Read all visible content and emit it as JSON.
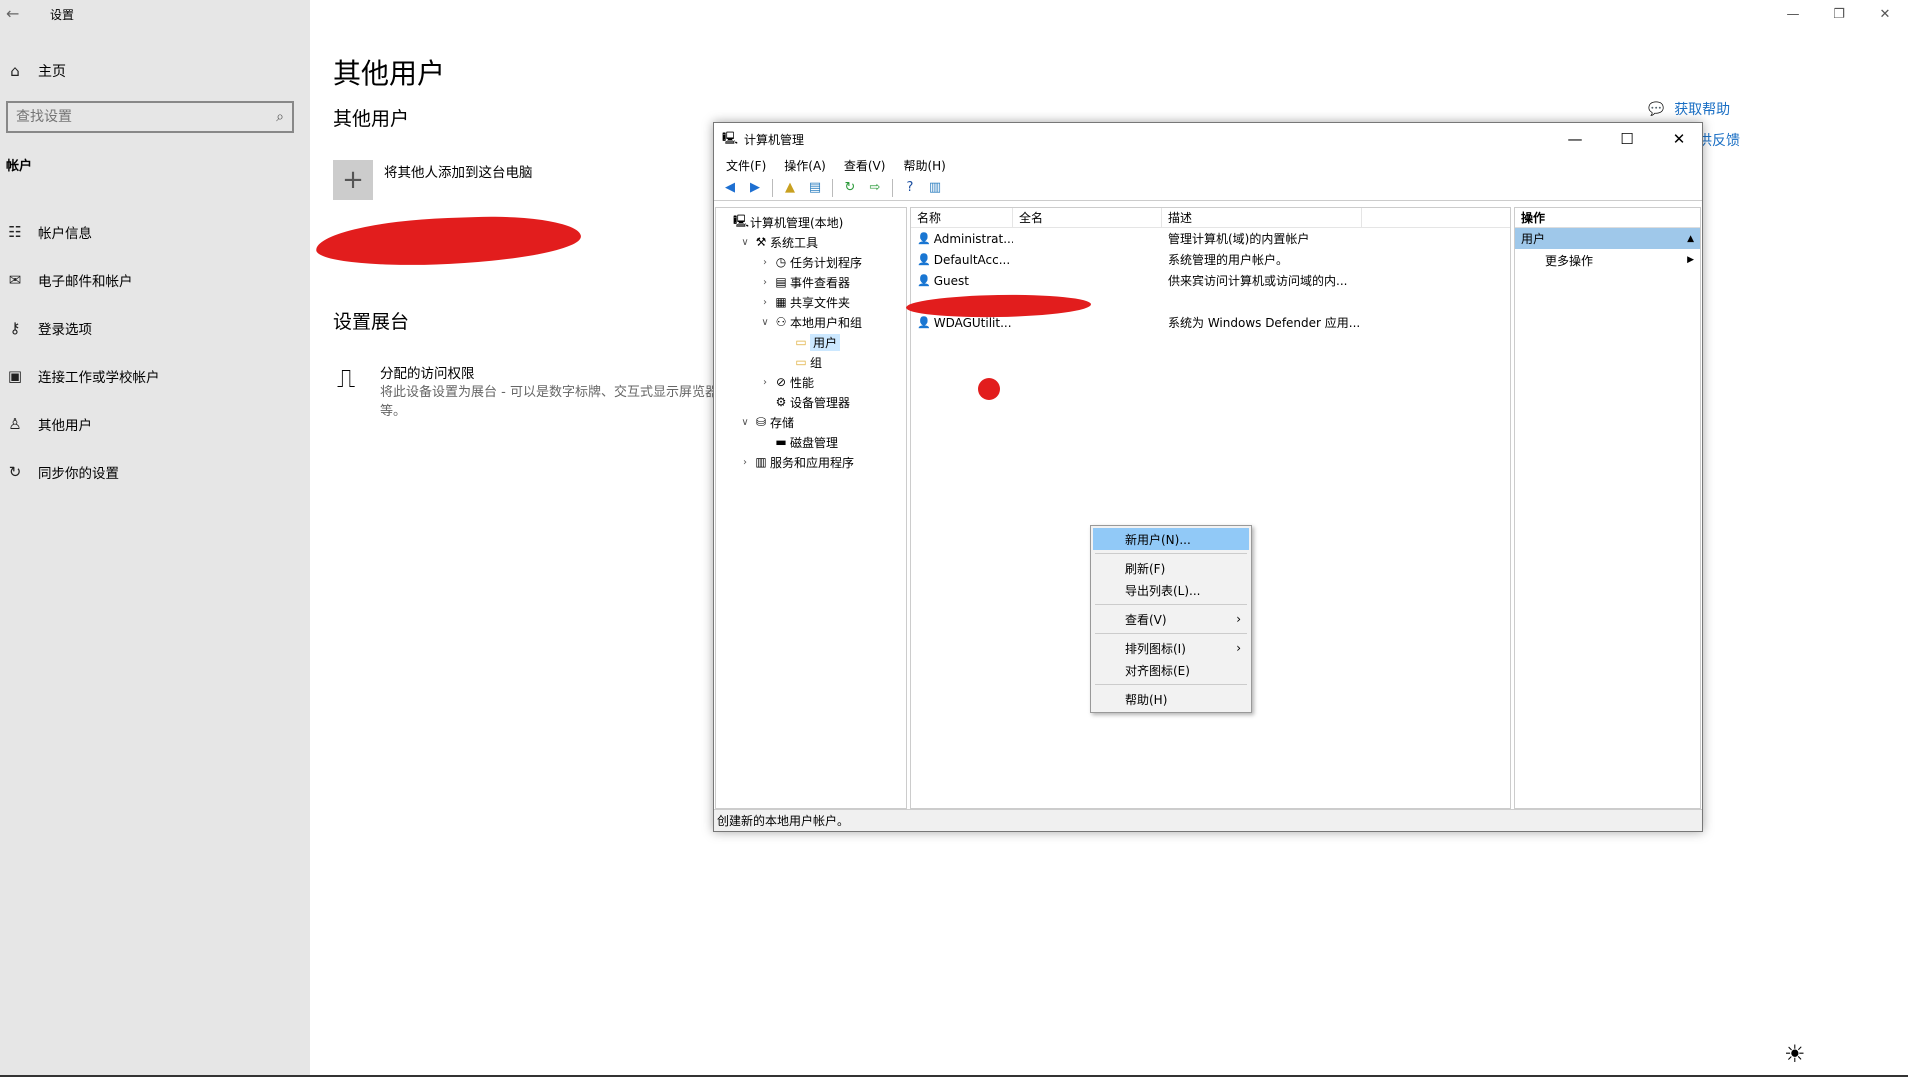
{
  "settings": {
    "title": "设置",
    "home": "主页",
    "search_placeholder": "查找设置",
    "section": "帐户",
    "nav": [
      {
        "label": "帐户信息",
        "icon": "person-card-icon",
        "glyph": "☷"
      },
      {
        "label": "电子邮件和帐户",
        "icon": "mail-icon",
        "glyph": "✉"
      },
      {
        "label": "登录选项",
        "icon": "key-icon",
        "glyph": "⚷"
      },
      {
        "label": "连接工作或学校帐户",
        "icon": "briefcase-icon",
        "glyph": "▣"
      },
      {
        "label": "其他用户",
        "icon": "person-add-icon",
        "glyph": "♙"
      },
      {
        "label": "同步你的设置",
        "icon": "sync-icon",
        "glyph": "↻"
      }
    ],
    "page_title": "其他用户",
    "other_users_heading": "其他用户",
    "add_user_label": "将其他人添加到这台电脑",
    "kiosk_heading": "设置展台",
    "kiosk_title": "分配的访问权限",
    "kiosk_desc": "将此设备设置为展台 - 可以是数字标牌、交互式显示屏览器等。",
    "help_link": "获取帮助",
    "feedback_link": "供反馈"
  },
  "cm": {
    "title": "计算机管理",
    "menu": [
      "文件(F)",
      "操作(A)",
      "查看(V)",
      "帮助(H)"
    ],
    "tree": [
      {
        "label": "计算机管理(本地)",
        "depth": 0,
        "exp": "",
        "icon": "computer-icon",
        "glyph": "🖳"
      },
      {
        "label": "系统工具",
        "depth": 1,
        "exp": "∨",
        "icon": "tools-icon",
        "glyph": "⚒"
      },
      {
        "label": "任务计划程序",
        "depth": 2,
        "exp": "›",
        "icon": "clock-icon",
        "glyph": "◷"
      },
      {
        "label": "事件查看器",
        "depth": 2,
        "exp": "›",
        "icon": "event-viewer-icon",
        "glyph": "▤"
      },
      {
        "label": "共享文件夹",
        "depth": 2,
        "exp": "›",
        "icon": "shared-folder-icon",
        "glyph": "▦"
      },
      {
        "label": "本地用户和组",
        "depth": 2,
        "exp": "∨",
        "icon": "users-group-icon",
        "glyph": "⚇"
      },
      {
        "label": "用户",
        "depth": 3,
        "exp": "",
        "icon": "folder-icon",
        "glyph": "▭",
        "selected": true
      },
      {
        "label": "组",
        "depth": 3,
        "exp": "",
        "icon": "folder-icon",
        "glyph": "▭"
      },
      {
        "label": "性能",
        "depth": 2,
        "exp": "›",
        "icon": "performance-icon",
        "glyph": "⊘"
      },
      {
        "label": "设备管理器",
        "depth": 2,
        "exp": "",
        "icon": "device-manager-icon",
        "glyph": "⚙"
      },
      {
        "label": "存储",
        "depth": 1,
        "exp": "∨",
        "icon": "storage-icon",
        "glyph": "⛁"
      },
      {
        "label": "磁盘管理",
        "depth": 2,
        "exp": "",
        "icon": "disk-icon",
        "glyph": "▬"
      },
      {
        "label": "服务和应用程序",
        "depth": 1,
        "exp": "›",
        "icon": "services-icon",
        "glyph": "▥"
      }
    ],
    "columns": [
      "名称",
      "全名",
      "描述"
    ],
    "rows": [
      {
        "name": "Administrat...",
        "full": "",
        "desc": "管理计算机(域)的内置帐户"
      },
      {
        "name": "DefaultAcc...",
        "full": "",
        "desc": "系统管理的用户帐户。"
      },
      {
        "name": "Guest",
        "full": "",
        "desc": "供来宾访问计算机或访问域的内..."
      },
      {
        "name": "",
        "full": "",
        "desc": ""
      },
      {
        "name": "WDAGUtilit...",
        "full": "",
        "desc": "系统为 Windows Defender 应用..."
      }
    ],
    "actions_heading": "操作",
    "actions_selected": "用户",
    "actions_more": "更多操作",
    "status": "创建新的本地用户帐户。"
  },
  "context_menu": [
    {
      "label": "新用户(N)...",
      "highlight": true
    },
    {
      "sep": true
    },
    {
      "label": "刷新(F)"
    },
    {
      "label": "导出列表(L)..."
    },
    {
      "sep": true
    },
    {
      "label": "查看(V)",
      "sub": true
    },
    {
      "sep": true
    },
    {
      "label": "排列图标(I)",
      "sub": true
    },
    {
      "label": "对齐图标(E)"
    },
    {
      "sep": true
    },
    {
      "label": "帮助(H)"
    }
  ]
}
